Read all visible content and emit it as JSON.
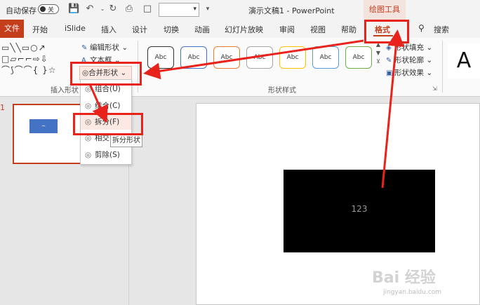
{
  "titlebar": {
    "autosave_label": "自动保存",
    "autosave_state": "关",
    "doc_title": "演示文稿1  -  PowerPoint",
    "context_group": "绘图工具"
  },
  "tabs": [
    "文件",
    "开始",
    "iSlide",
    "插入",
    "设计",
    "切换",
    "动画",
    "幻灯片放映",
    "审阅",
    "视图",
    "帮助",
    "格式",
    "搜索"
  ],
  "ribbon": {
    "edit_shape": "编辑形状",
    "text_box": "文本框",
    "merge_shapes": "合并形状",
    "insert_shapes_label": "插入形状",
    "shape_styles_label": "形状样式",
    "style_sample": "Abc",
    "shape_fill": "形状填充",
    "shape_outline": "形状轮廓",
    "shape_effects": "形状效果",
    "wordart_sample": "A",
    "style_colors": [
      "#333333",
      "#4472c4",
      "#ed7d31",
      "#a5a5a5",
      "#ffc000",
      "#5b9bd5",
      "#70ad47"
    ]
  },
  "menu": {
    "items": [
      "组合(U)",
      "结合(C)",
      "拆分(F)",
      "相交(I)",
      "剪除(S)"
    ],
    "tooltip": "拆分形状"
  },
  "slides": {
    "number": "1",
    "rect_text": "123",
    "thumb_rect_text": "~"
  },
  "colors": {
    "accent": "#c43e1c",
    "highlight": "#e8231b",
    "blue_shape": "#4472c4"
  },
  "watermark": {
    "main": "Bai 经验",
    "sub": "jingyan.baidu.com"
  }
}
